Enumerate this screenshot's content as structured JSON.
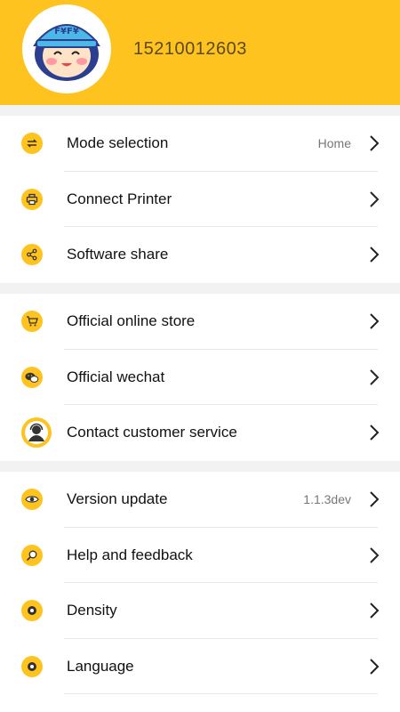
{
  "profile": {
    "avatar_text": "F¥F¥",
    "phone": "15210012603"
  },
  "groups": [
    {
      "items": [
        {
          "label": "Mode selection",
          "value": "Home",
          "icon": "swap-arrows-icon"
        },
        {
          "label": "Connect Printer",
          "value": "",
          "icon": "printer-icon"
        },
        {
          "label": "Software share",
          "value": "",
          "icon": "share-icon"
        }
      ]
    },
    {
      "items": [
        {
          "label": "Official online store",
          "value": "",
          "icon": "shopping-cart-icon"
        },
        {
          "label": "Official wechat",
          "value": "",
          "icon": "wechat-icon"
        },
        {
          "label": "Contact customer service",
          "value": "",
          "icon": "customer-service-icon"
        }
      ]
    },
    {
      "items": [
        {
          "label": "Version update",
          "value": "1.1.3dev",
          "icon": "version-eye-icon"
        },
        {
          "label": "Help and feedback",
          "value": "",
          "icon": "help-search-icon"
        },
        {
          "label": "Density",
          "value": "",
          "icon": "density-gear-icon"
        },
        {
          "label": "Language",
          "value": "",
          "icon": "language-gear-icon"
        }
      ]
    }
  ],
  "colors": {
    "accent": "#FFC31F",
    "separator": "#f2f2f2"
  }
}
